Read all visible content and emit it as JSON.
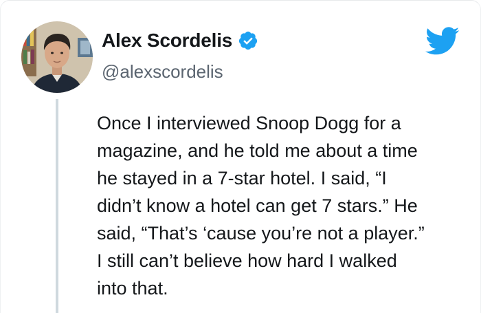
{
  "author": {
    "display_name": "Alex Scordelis",
    "handle": "@alexscordelis",
    "verified": true
  },
  "tweet": {
    "lines": [
      "Once I interviewed Snoop Dogg for a",
      "magazine, and he told me about a time",
      "he stayed in a 7-star hotel. I said, “I",
      "didn’t know a hotel can get 7 stars.” He",
      "said, “That’s ‘cause you’re not a player.”",
      "I still can’t believe how hard I walked",
      "into that."
    ]
  },
  "icons": {
    "brand": "twitter-bird-icon",
    "badge": "verified-badge-icon"
  },
  "colors": {
    "twitter_blue": "#1da1f2",
    "text": "#14171a",
    "secondary_text": "#5b6570",
    "thread_line": "#cfd9de"
  }
}
